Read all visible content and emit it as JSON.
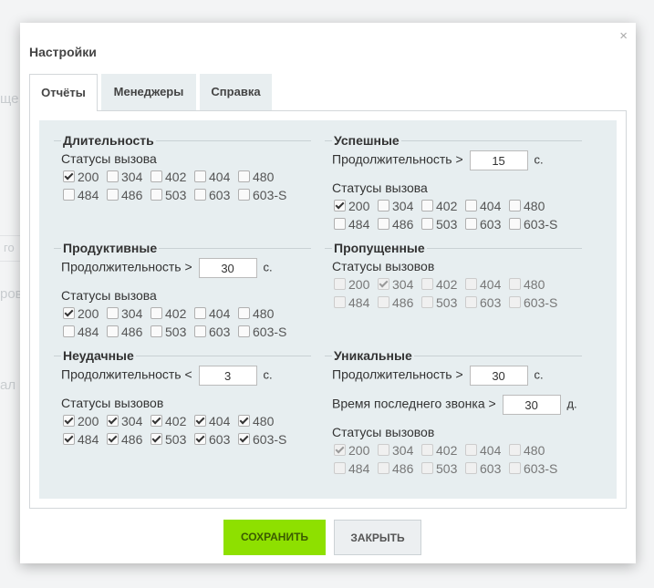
{
  "modal": {
    "title": "Настройки",
    "close_icon": "×"
  },
  "tabs": [
    {
      "label": "Отчёты",
      "active": true
    },
    {
      "label": "Менеджеры",
      "active": false
    },
    {
      "label": "Справка",
      "active": false
    }
  ],
  "codes": [
    "200",
    "304",
    "402",
    "404",
    "480",
    "484",
    "486",
    "503",
    "603",
    "603-S"
  ],
  "sections": {
    "duration": {
      "title": "Длительность",
      "statuses_label": "Статусы вызова",
      "checked": [
        true,
        false,
        false,
        false,
        false,
        false,
        false,
        false,
        false,
        false
      ]
    },
    "successful": {
      "title": "Успешные",
      "duration_label": "Продолжительность >",
      "duration_value": "15",
      "unit": "с.",
      "statuses_label": "Статусы вызова",
      "checked": [
        true,
        false,
        false,
        false,
        false,
        false,
        false,
        false,
        false,
        false
      ]
    },
    "productive": {
      "title": "Продуктивные",
      "duration_label": "Продолжительность >",
      "duration_value": "30",
      "unit": "с.",
      "statuses_label": "Статусы вызова",
      "checked": [
        true,
        false,
        false,
        false,
        false,
        false,
        false,
        false,
        false,
        false
      ]
    },
    "missed": {
      "title": "Пропущенные",
      "statuses_label": "Статусы вызовов",
      "checked": [
        false,
        true,
        false,
        false,
        false,
        false,
        false,
        false,
        false,
        false
      ]
    },
    "failed": {
      "title": "Неудачные",
      "duration_label": "Продолжительность <",
      "duration_value": "3",
      "unit": "с.",
      "statuses_label": "Статусы вызовов",
      "checked": [
        true,
        true,
        true,
        true,
        true,
        true,
        true,
        true,
        true,
        true
      ]
    },
    "unique": {
      "title": "Уникальные",
      "duration_label": "Продолжительность >",
      "duration_value": "30",
      "unit": "с.",
      "last_call_label": "Время последнего звонка >",
      "last_call_value": "30",
      "last_call_unit": "д.",
      "statuses_label": "Статусы вызовов",
      "checked": [
        true,
        false,
        false,
        false,
        false,
        false,
        false,
        false,
        false,
        false
      ]
    }
  },
  "buttons": {
    "save": "СОХРАНИТЬ",
    "close": "ЗАКРЫТЬ"
  },
  "background": {
    "fragments": [
      "ще",
      "го",
      "ров",
      "ал"
    ]
  }
}
